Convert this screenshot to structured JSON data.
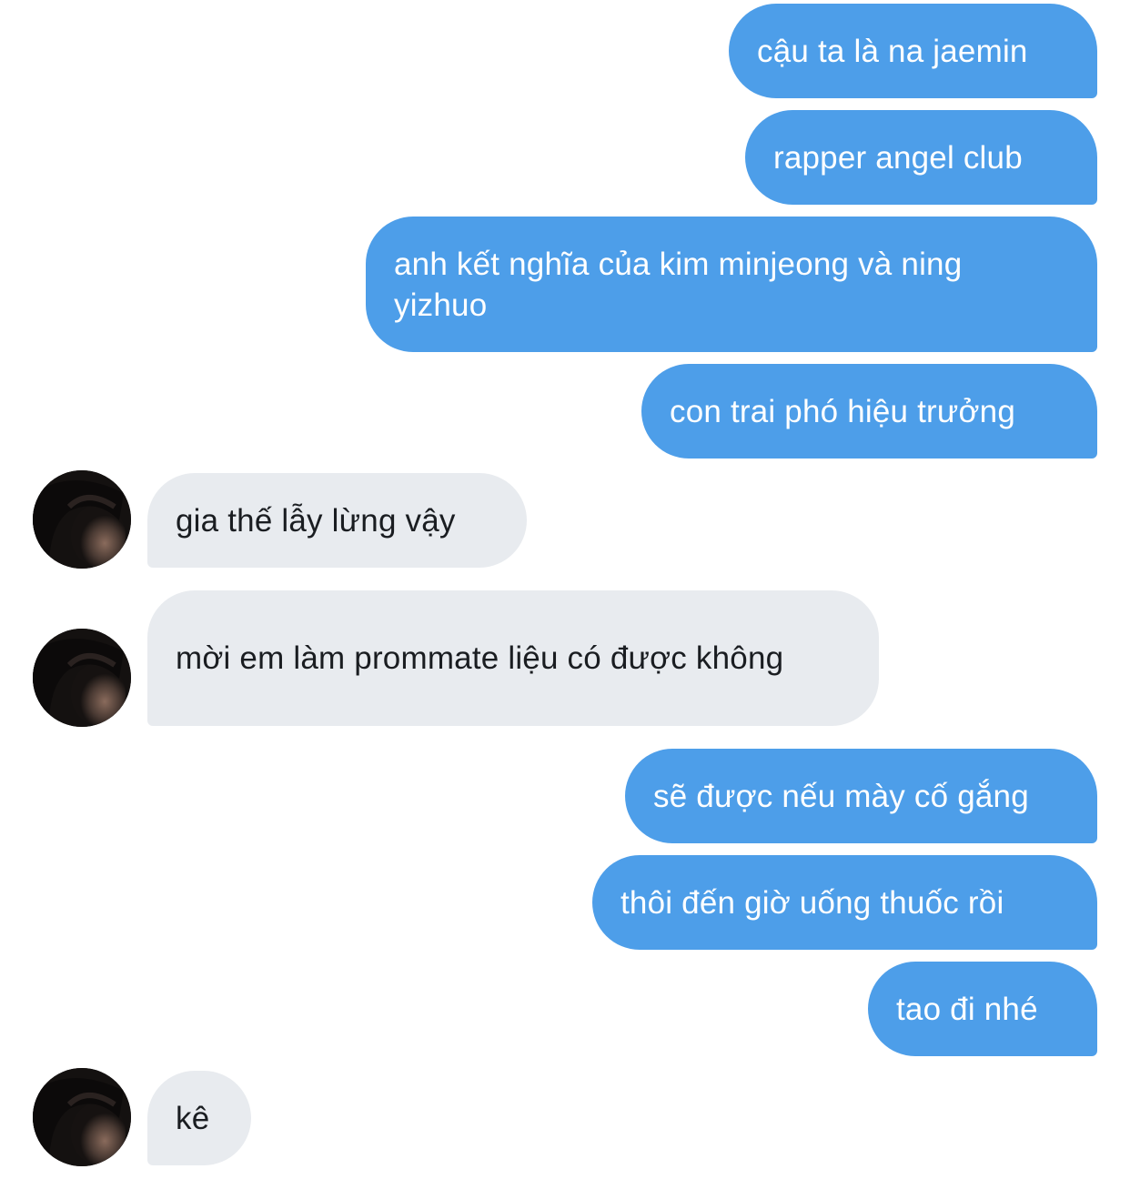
{
  "messages": [
    {
      "side": "sent",
      "text": "cậu ta là na jaemin"
    },
    {
      "side": "sent",
      "text": "rapper angel club"
    },
    {
      "side": "sent",
      "text": "anh kết nghĩa của kim minjeong và ning yizhuo"
    },
    {
      "side": "sent",
      "text": "con trai phó hiệu trưởng"
    },
    {
      "side": "received",
      "text": "gia thế lẫy lừng vậy"
    },
    {
      "side": "received",
      "text": "mời em làm prommate liệu có được không"
    },
    {
      "side": "sent",
      "text": "sẽ được nếu mày cố gắng"
    },
    {
      "side": "sent",
      "text": "thôi đến giờ uống thuốc rồi"
    },
    {
      "side": "sent",
      "text": "tao đi nhé"
    },
    {
      "side": "received",
      "text": "kê"
    }
  ],
  "colors": {
    "sent_bubble": "#4d9ee9",
    "received_bubble": "#e8ebef",
    "sent_text": "#ffffff",
    "received_text": "#1a1d21"
  },
  "icons": {
    "contact_avatar": "profile-photo-avatar"
  }
}
